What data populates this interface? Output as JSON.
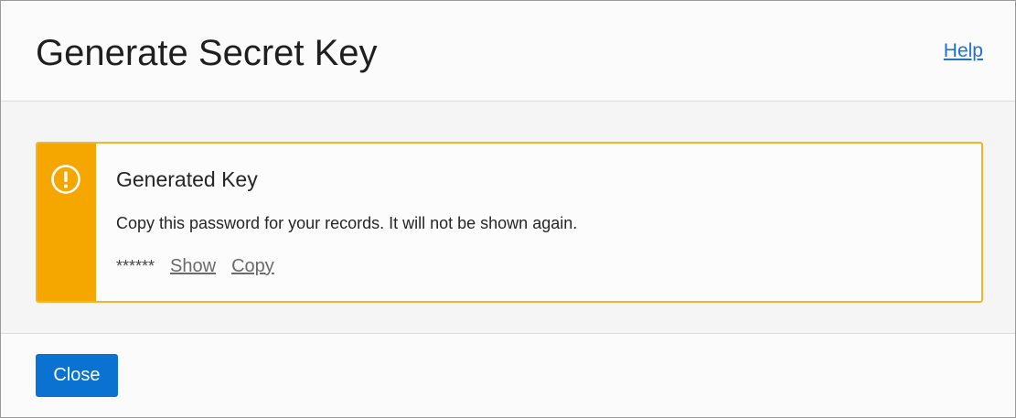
{
  "dialog": {
    "title": "Generate Secret Key",
    "help_label": "Help"
  },
  "banner": {
    "icon": "warning-icon",
    "heading": "Generated Key",
    "message": "Copy this password for your records. It will not be shown again.",
    "masked_key": "******",
    "show_label": "Show",
    "copy_label": "Copy",
    "colors": {
      "stripe": "#f5a700",
      "border": "#f2b52a"
    }
  },
  "footer": {
    "close_label": "Close",
    "close_color": "#0a73d1"
  }
}
